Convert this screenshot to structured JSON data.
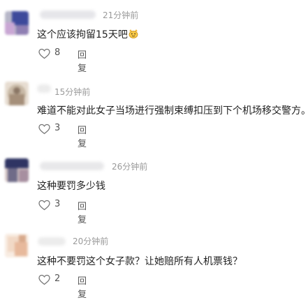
{
  "comments": [
    {
      "time": "21分钟前",
      "text": "这个应该拘留15天吧",
      "emoji": "cat-emoji",
      "likes": "8",
      "reply": "回复",
      "avatar_colors": [
        "#3d4a9b",
        "#c9a7d4",
        "#b7b7c8",
        "#8f7fb3"
      ]
    },
    {
      "time": "15分钟前",
      "text": "难道不能对此女子当场进行强制束缚扣压到下个机场移交警方。",
      "likes": "3",
      "reply": "回复",
      "avatar_colors": [
        "#c8b9a6",
        "#a58f7a",
        "#e7ddd1",
        "#8a7665"
      ]
    },
    {
      "time": "26分钟前",
      "text": "这种要罚多少钱",
      "likes": "3",
      "reply": "回复",
      "avatar_colors": [
        "#2f3463",
        "#6f6b88",
        "#d7c8c7",
        "#a78fa0"
      ]
    },
    {
      "time": "20分钟前",
      "text": "这种不要罚这个女子款？让她赔所有人机票钱？",
      "likes": "2",
      "reply": "回复",
      "avatar_colors": [
        "#f1d9c6",
        "#e7b99c",
        "#f8ece2",
        "#d8a98b"
      ]
    }
  ]
}
